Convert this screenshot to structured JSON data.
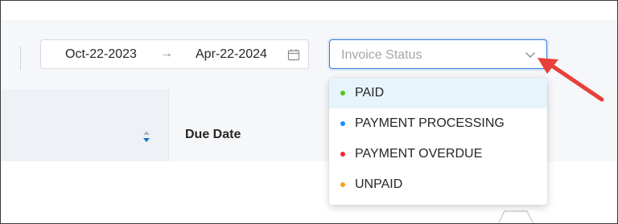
{
  "filters": {
    "date_range": {
      "start": "Oct-22-2023",
      "separator": "→",
      "end": "Apr-22-2024",
      "icon": "calendar-icon"
    },
    "status_select": {
      "placeholder": "Invoice Status",
      "icon": "chevron-down-icon",
      "expanded": true
    }
  },
  "table": {
    "columns": [
      {
        "label": "Due Date",
        "sort_icon": "sort-icon"
      }
    ]
  },
  "status_options": [
    {
      "label": "PAID",
      "color": "#52c41a",
      "highlighted": true
    },
    {
      "label": "PAYMENT PROCESSING",
      "color": "#1890ff",
      "highlighted": false
    },
    {
      "label": "PAYMENT OVERDUE",
      "color": "#f5222d",
      "highlighted": false
    },
    {
      "label": "UNPAID",
      "color": "#fa9f1e",
      "highlighted": false
    }
  ],
  "annotation": {
    "arrow_color": "#e8403a",
    "target": "status-select-chevron"
  },
  "colors": {
    "focus_border": "#2f7fd6",
    "highlight_bg": "#e6f4fb"
  }
}
